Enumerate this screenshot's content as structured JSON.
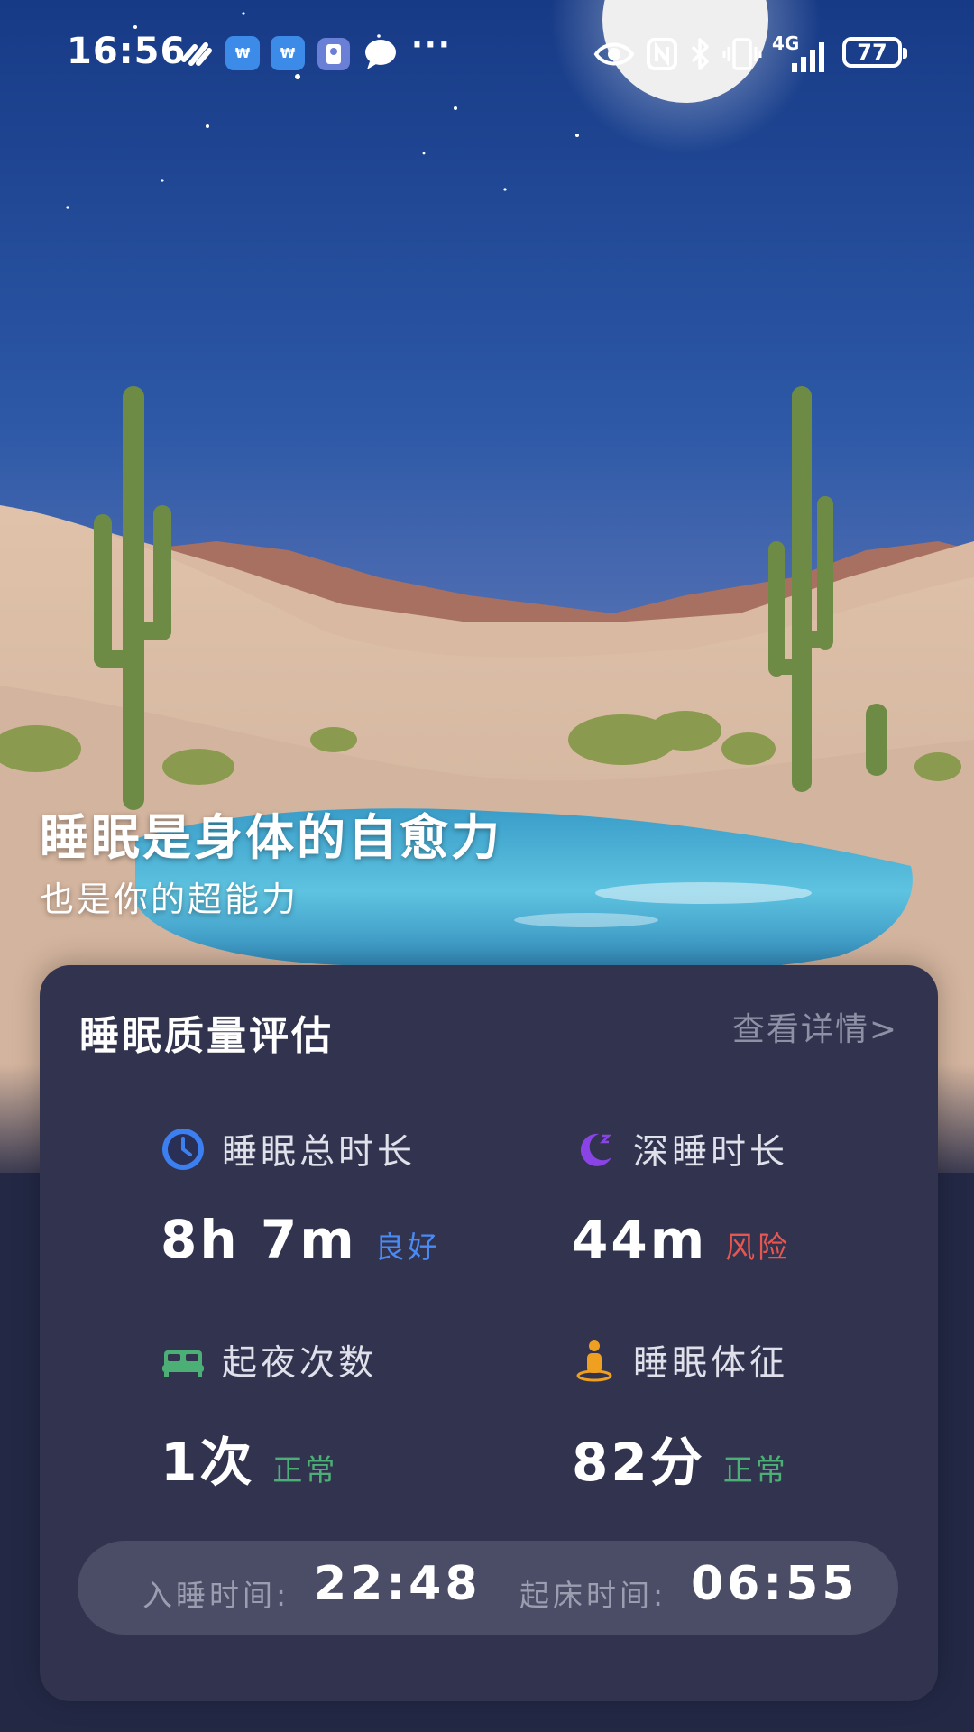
{
  "status_bar": {
    "time": "16:56",
    "network": "4G",
    "battery": "77",
    "app_badge_1": "₩",
    "app_badge_2": "₩",
    "more": "···"
  },
  "hero": {
    "title": "睡眠是身体的自愈力",
    "subtitle": "也是你的超能力"
  },
  "card": {
    "title": "睡眠质量评估",
    "detail_link": "查看详情>",
    "metrics": [
      {
        "icon": "clock-icon",
        "label": "睡眠总时长",
        "value": "8h 7m",
        "status": "良好",
        "status_color": "#4a8af4"
      },
      {
        "icon": "moon-icon",
        "label": "深睡时长",
        "value": "44m",
        "status": "风险",
        "status_color": "#e8564f"
      },
      {
        "icon": "bed-icon",
        "label": "起夜次数",
        "value": "1次",
        "status": "正常",
        "status_color": "#4caf76"
      },
      {
        "icon": "person-icon",
        "label": "睡眠体征",
        "value": "82分",
        "status": "正常",
        "status_color": "#4caf76"
      }
    ],
    "sleep_time_label": "入睡时间:",
    "sleep_time": "22:48",
    "wake_time_label": "起床时间:",
    "wake_time": "06:55"
  },
  "colors": {
    "card_bg": "#32344f",
    "page_bg": "#232845",
    "good": "#4a8af4",
    "risk": "#e8564f",
    "normal": "#4caf76"
  }
}
